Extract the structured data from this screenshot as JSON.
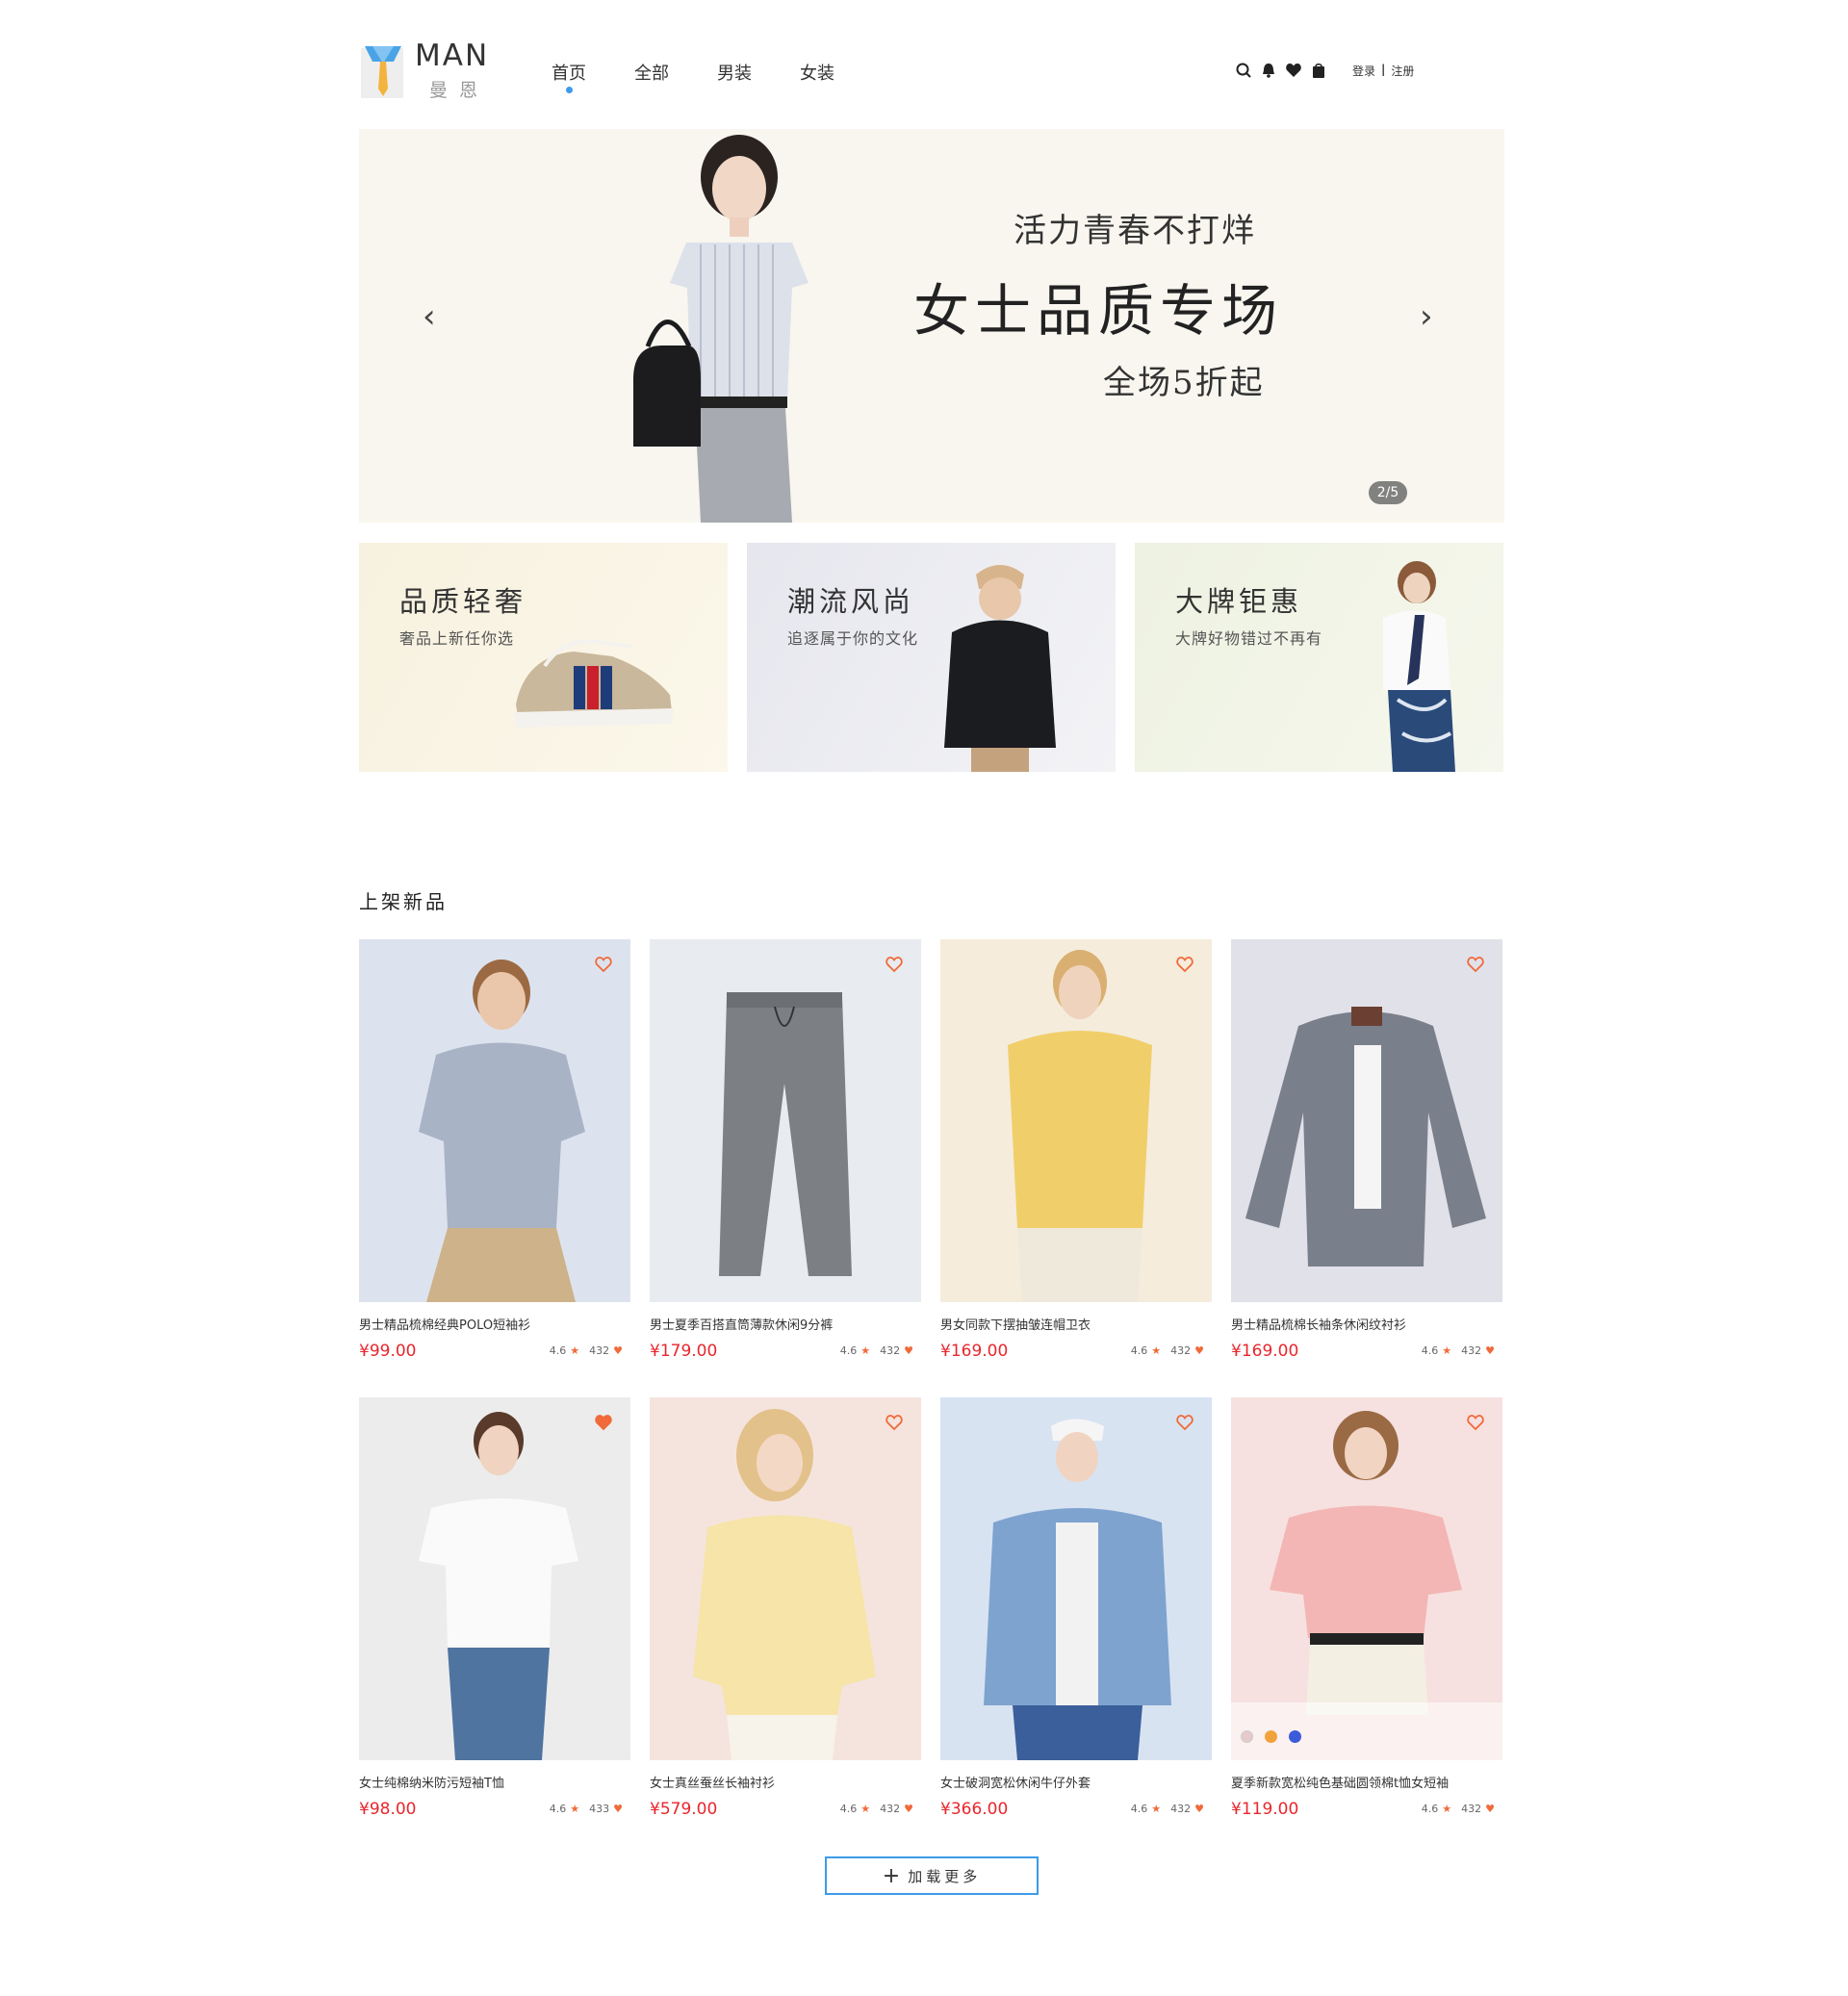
{
  "brand": {
    "name": "MAN",
    "sub": "曼恩"
  },
  "nav": {
    "items": [
      "首页",
      "全部",
      "男装",
      "女装"
    ],
    "active": 0
  },
  "auth": {
    "login": "登录",
    "sep": "|",
    "register": "注册"
  },
  "banner": {
    "line1": "活力青春不打烊",
    "line2": "女士品质专场",
    "line3": "全场5折起",
    "prev": "‹",
    "next": "›",
    "page": "2/5"
  },
  "promos": [
    {
      "title": "品质轻奢",
      "sub": "奢品上新任你选",
      "bg": "#f6f0de"
    },
    {
      "title": "潮流风尚",
      "sub": "追逐属于你的文化",
      "bg": "#e7e8ee"
    },
    {
      "title": "大牌钜惠",
      "sub": "大牌好物错过不再有",
      "bg": "#eef1e0"
    }
  ],
  "section": {
    "title": "上架新品"
  },
  "products": [
    {
      "name": "男士精品梳棉经典POLO短袖衫",
      "price": "¥99.00",
      "rating": "4.6",
      "likes": "432",
      "bg": "#dde3ee",
      "favorited": false
    },
    {
      "name": "男士夏季百搭直筒薄款休闲9分裤",
      "price": "¥179.00",
      "rating": "4.6",
      "likes": "432",
      "bg": "#e8ebef",
      "favorited": false
    },
    {
      "name": "男女同款下摆抽皱连帽卫衣",
      "price": "¥169.00",
      "rating": "4.6",
      "likes": "432",
      "bg": "#f5ecdc",
      "favorited": false
    },
    {
      "name": "男士精品梳棉长袖条休闲纹衬衫",
      "price": "¥169.00",
      "rating": "4.6",
      "likes": "432",
      "bg": "#e1e1e9",
      "favorited": false
    },
    {
      "name": "女士纯棉纳米防污短袖T恤",
      "price": "¥98.00",
      "rating": "4.6",
      "likes": "433",
      "bg": "#ececec",
      "favorited": true
    },
    {
      "name": "女士真丝蚕丝长袖衬衫",
      "price": "¥579.00",
      "rating": "4.6",
      "likes": "432",
      "bg": "#f5e4dd",
      "favorited": false
    },
    {
      "name": "女士破洞宽松休闲牛仔外套",
      "price": "¥366.00",
      "rating": "4.6",
      "likes": "432",
      "bg": "#d8e3f2",
      "favorited": false
    },
    {
      "name": "夏季新款宽松纯色基础圆领棉t恤女短袖",
      "price": "¥119.00",
      "rating": "4.6",
      "likes": "432",
      "bg": "#f6e1e0",
      "favorited": false
    }
  ],
  "swatch_colors": [
    "#e6c9c9",
    "#f2a23a",
    "#3b5bdb"
  ],
  "load_more": "加载更多",
  "colors": {
    "accent": "#3d9be9",
    "price": "#e8262d",
    "heart": "#f06a3a"
  },
  "icons": [
    "search-icon",
    "bell-icon",
    "heart-icon",
    "bag-icon",
    "star-icon",
    "plus-icon"
  ]
}
